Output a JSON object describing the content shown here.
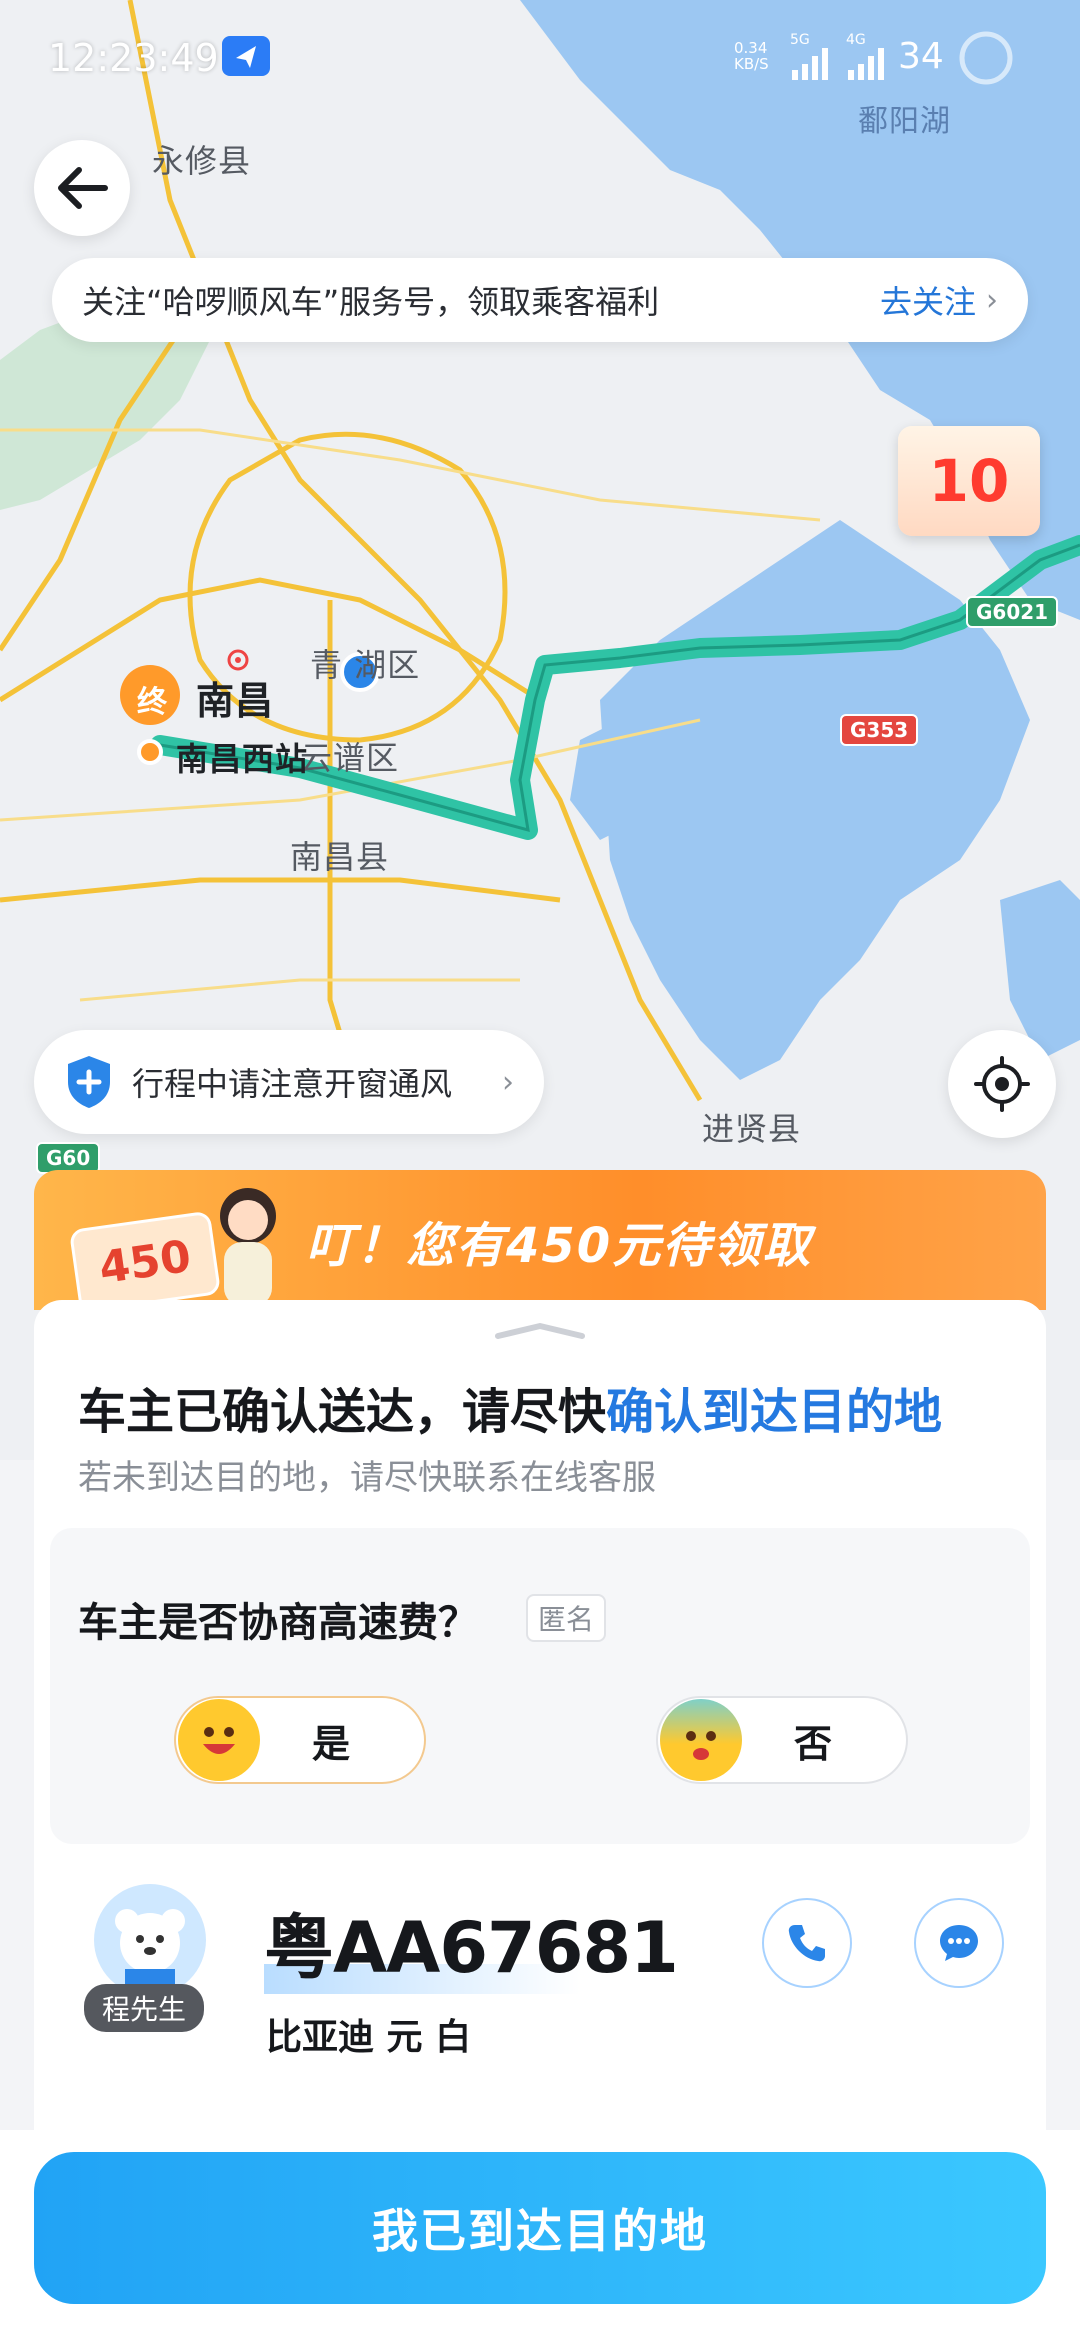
{
  "status_bar": {
    "time": "12:23:49",
    "net_speed_value": "0.34",
    "net_speed_unit": "KB/S",
    "signal_1": "5G",
    "signal_2": "4G",
    "battery": "34"
  },
  "map": {
    "labels": {
      "yongxiu": "永修县",
      "poyang_lake": "鄱阳湖",
      "nanchang": "南昌",
      "end_marker": "终",
      "qingshanhu": "青 湖区",
      "yunpu": "云谱区",
      "nanchang_west": "南昌西站",
      "nanchang_county": "南昌县",
      "jinxian": "进贤县"
    },
    "highways": [
      "G6021",
      "G353",
      "G60"
    ],
    "route_color": "#2fc3a5"
  },
  "follow_banner": {
    "text": "关注“哈啰顺风车”服务号，领取乘客福利",
    "action": "去关注"
  },
  "promo_float": {
    "amount": "10"
  },
  "safety_tip": {
    "text": "行程中请注意开窗通风"
  },
  "reward_banner": {
    "badge": "450",
    "title": "叮！您有450元待领取"
  },
  "card": {
    "heading_prefix": "车主已确认送达，请尽快",
    "heading_highlight": "确认到达目的地",
    "subtext": "若未到达目的地，请尽快联系在线客服",
    "survey": {
      "question": "车主是否协商高速费？",
      "tag": "匿名",
      "option_yes": "是",
      "option_no": "否"
    },
    "driver": {
      "name": "程先生",
      "plate": "粤AA67681",
      "car": "比亚迪 元 白"
    }
  },
  "confirm_button": "我已到达目的地",
  "colors": {
    "accent": "#2479e0",
    "button": "#21a3f5",
    "banner": "#ff8e2a"
  }
}
